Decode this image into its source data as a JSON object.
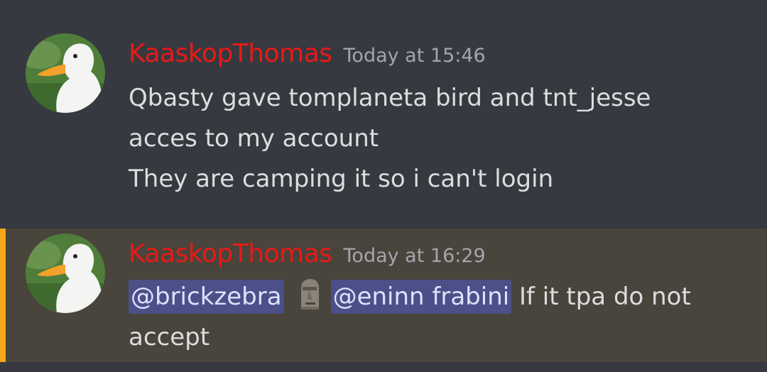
{
  "colors": {
    "background": "#36393f",
    "highlighted_background": "#49443c",
    "mention_bar": "#faa61a",
    "username": "#e91916",
    "timestamp": "#a3a6aa",
    "text": "#dcddde",
    "mention_bg": "#4c5089",
    "mention_text": "#dee0fc"
  },
  "messages": [
    {
      "avatar_icon": "duck-avatar",
      "username": "KaaskopThomas",
      "timestamp": "Today at 15:46",
      "lines": [
        "Qbasty gave tomplaneta bird and tnt_jesse",
        "acces to my account",
        "They are camping it so i can't login"
      ]
    },
    {
      "avatar_icon": "duck-avatar",
      "username": "KaaskopThomas",
      "timestamp": "Today at 16:29",
      "highlighted": true,
      "mention_1": "@brickzebra",
      "emoji_icon": "moai-emoji",
      "mention_2": "@eninn frabini",
      "text_after": " If it tpa do not",
      "line_2": "accept"
    }
  ]
}
